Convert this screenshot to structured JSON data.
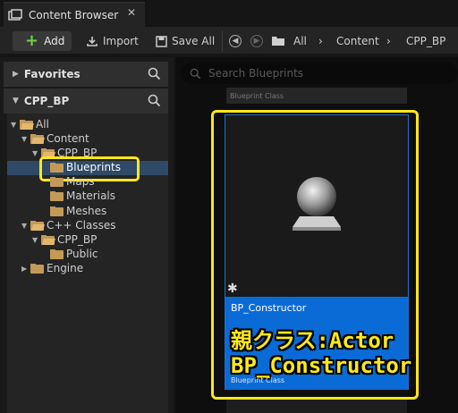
{
  "tab": {
    "title": "Content Browser"
  },
  "toolbar": {
    "add_label": "Add",
    "import_label": "Import",
    "save_all_label": "Save All",
    "breadcrumb": [
      "All",
      "Content",
      "CPP_BP"
    ]
  },
  "sidebar": {
    "favorites_label": "Favorites",
    "project_label": "CPP_BP",
    "tree": [
      {
        "label": "All"
      },
      {
        "label": "Content"
      },
      {
        "label": "CPP_BP"
      },
      {
        "label": "Blueprints"
      },
      {
        "label": "Maps"
      },
      {
        "label": "Materials"
      },
      {
        "label": "Meshes"
      },
      {
        "label": "C++ Classes"
      },
      {
        "label": "CPP_BP"
      },
      {
        "label": "Public"
      },
      {
        "label": "Engine"
      }
    ]
  },
  "search": {
    "placeholder": "Search Blueprints"
  },
  "assets": {
    "previous_type": "Blueprint Class",
    "card": {
      "name": "BP_Constructor",
      "type": "Blueprint Class"
    }
  },
  "annotation": {
    "line1": "親クラス:Actor",
    "line2": "BP_Constructor"
  },
  "colors": {
    "highlight": "#ffe81a",
    "card_selected": "#0b6bd6",
    "add_plus": "#6fd34a"
  }
}
